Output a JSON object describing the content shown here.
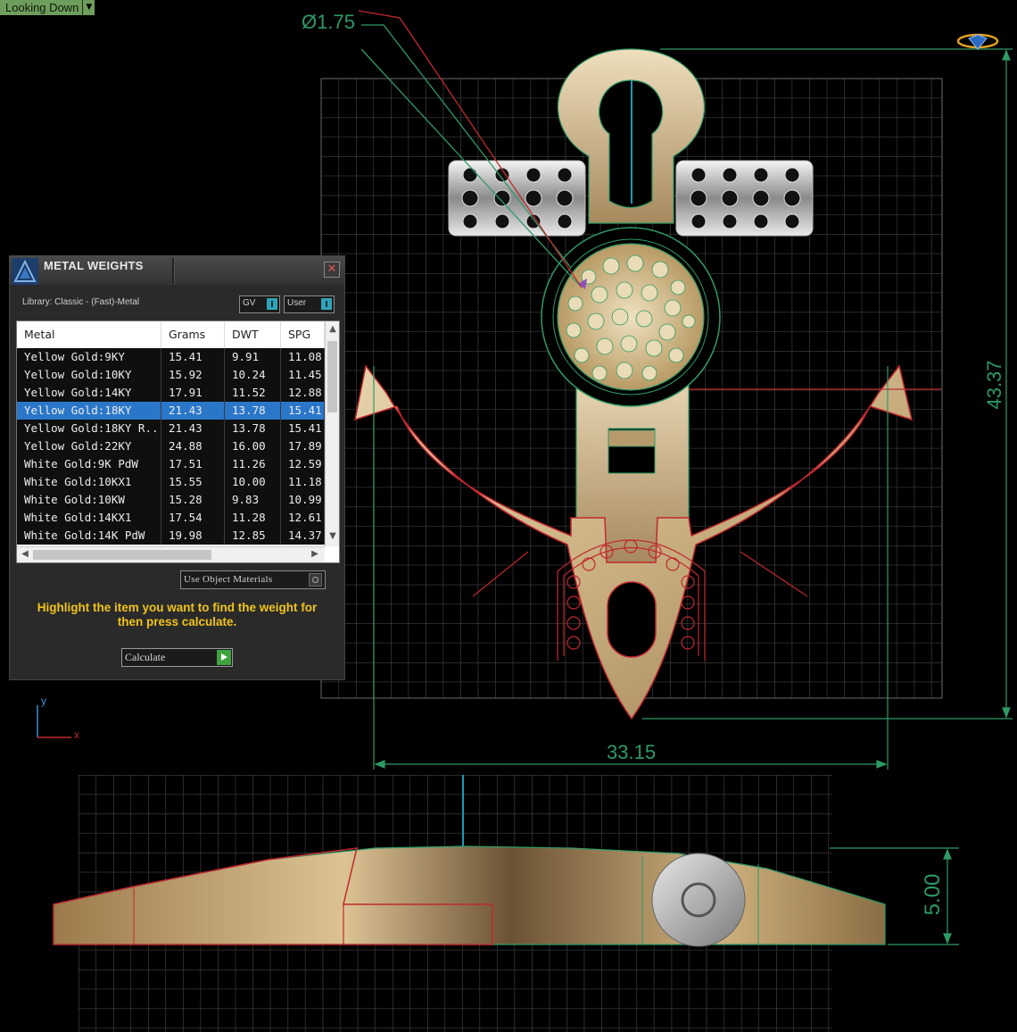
{
  "viewport": {
    "view_label": "Looking Down",
    "dimension_diameter": "Ø1.75",
    "dimension_height": "43.37",
    "dimension_width": "33.15",
    "dimension_thickness": "5.00",
    "axis_y_label": "y",
    "axis_x_label": "x"
  },
  "panel": {
    "title": "METAL WEIGHTS",
    "library_label": "Library: Classic - (Fast)-Metal",
    "toggle_gv": "GV",
    "toggle_user": "User",
    "columns": [
      "Metal",
      "Grams",
      "DWT",
      "SPG"
    ],
    "rows": [
      {
        "metal": "Yellow Gold:9KY",
        "grams": "15.41",
        "dwt": "9.91",
        "spg": "11.08",
        "selected": false
      },
      {
        "metal": "Yellow Gold:10KY",
        "grams": "15.92",
        "dwt": "10.24",
        "spg": "11.45",
        "selected": false
      },
      {
        "metal": "Yellow Gold:14KY",
        "grams": "17.91",
        "dwt": "11.52",
        "spg": "12.88",
        "selected": false
      },
      {
        "metal": "Yellow Gold:18KY",
        "grams": "21.43",
        "dwt": "13.78",
        "spg": "15.41",
        "selected": true
      },
      {
        "metal": "Yellow Gold:18KY R...",
        "grams": "21.43",
        "dwt": "13.78",
        "spg": "15.41",
        "selected": false
      },
      {
        "metal": "Yellow Gold:22KY",
        "grams": "24.88",
        "dwt": "16.00",
        "spg": "17.89",
        "selected": false
      },
      {
        "metal": "White Gold:9K PdW",
        "grams": "17.51",
        "dwt": "11.26",
        "spg": "12.59",
        "selected": false
      },
      {
        "metal": "White Gold:10KX1",
        "grams": "15.55",
        "dwt": "10.00",
        "spg": "11.18",
        "selected": false
      },
      {
        "metal": "White Gold:10KW",
        "grams": "15.28",
        "dwt": "9.83",
        "spg": "10.99",
        "selected": false
      },
      {
        "metal": "White Gold:14KX1",
        "grams": "17.54",
        "dwt": "11.28",
        "spg": "12.61",
        "selected": false
      },
      {
        "metal": "White Gold:14K PdW",
        "grams": "19.98",
        "dwt": "12.85",
        "spg": "14.37",
        "selected": false
      }
    ],
    "use_object_materials": "Use Object Materials",
    "instructions": "Highlight the item you want to find the weight for then press calculate.",
    "calculate_label": "Calculate",
    "colors": {
      "selected_row": "#2a77c9",
      "instruction_text": "#f0c419",
      "toggle_on": "#2fa4b9",
      "calculate_go": "#3ea33e"
    }
  },
  "icons": [
    "dropdown-arrow-icon",
    "app-logo-icon",
    "close-icon",
    "scroll-up-icon",
    "scroll-down-icon",
    "scroll-left-icon",
    "scroll-right-icon",
    "play-icon",
    "view-cube-icon"
  ]
}
